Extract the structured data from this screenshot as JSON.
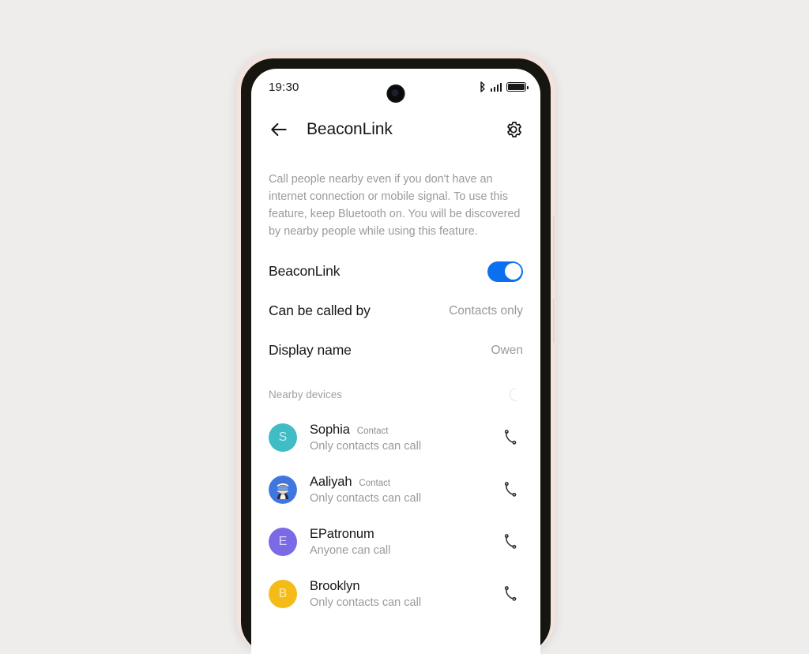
{
  "colors": {
    "page_background": "#eeedec",
    "phone_frame": "#f3e3dc",
    "bezel": "#17150f",
    "screen": "#ffffff",
    "accent_toggle_on": "#0b70f0",
    "primary_text": "#17171a",
    "secondary_text": "#9a9a9e"
  },
  "status_bar": {
    "time": "19:30",
    "bluetooth_icon": "bluetooth-icon",
    "signal_icon": "cellular-signal-icon",
    "battery_icon": "battery-full-icon"
  },
  "app_bar": {
    "back_icon": "back-arrow-icon",
    "title": "BeaconLink",
    "settings_icon": "gear-icon"
  },
  "description": "Call people nearby even if you don't have an internet connection or mobile signal. To use this feature, keep Bluetooth on. You will be discovered by nearby people while using this feature.",
  "settings": [
    {
      "name": "beaconlink",
      "label": "BeaconLink",
      "type": "toggle",
      "value": "on",
      "value_text": ""
    },
    {
      "name": "can-be-called-by",
      "label": "Can be called by",
      "type": "value",
      "value_text": "Contacts only"
    },
    {
      "name": "display-name",
      "label": "Display name",
      "type": "value",
      "value_text": "Owen"
    }
  ],
  "nearby": {
    "header": "Nearby devices",
    "spinner_icon": "loading-spinner-icon",
    "devices": [
      {
        "name": "Sophia",
        "tag": "Contact",
        "subtitle": "Only contacts can call",
        "avatar_type": "initial",
        "avatar_initial": "S",
        "avatar_color": "#3fbcc4",
        "avatar_text_color": "#c9eef1",
        "call_icon": "phone-call-icon"
      },
      {
        "name": "Aaliyah",
        "tag": "Contact",
        "subtitle": "Only contacts can call",
        "avatar_type": "photo",
        "avatar_initial": "",
        "avatar_color": "#3f76e0",
        "avatar_text_color": "#ffffff",
        "call_icon": "phone-call-icon"
      },
      {
        "name": "EPatronum",
        "tag": "",
        "subtitle": "Anyone can call",
        "avatar_type": "initial",
        "avatar_initial": "E",
        "avatar_color": "#7a6ae6",
        "avatar_text_color": "#ded9fb",
        "call_icon": "phone-call-icon"
      },
      {
        "name": "Brooklyn",
        "tag": "",
        "subtitle": "Only contacts can call",
        "avatar_type": "initial",
        "avatar_initial": "B",
        "avatar_color": "#f5bb17",
        "avatar_text_color": "#fdeab4",
        "call_icon": "phone-call-icon"
      }
    ]
  }
}
